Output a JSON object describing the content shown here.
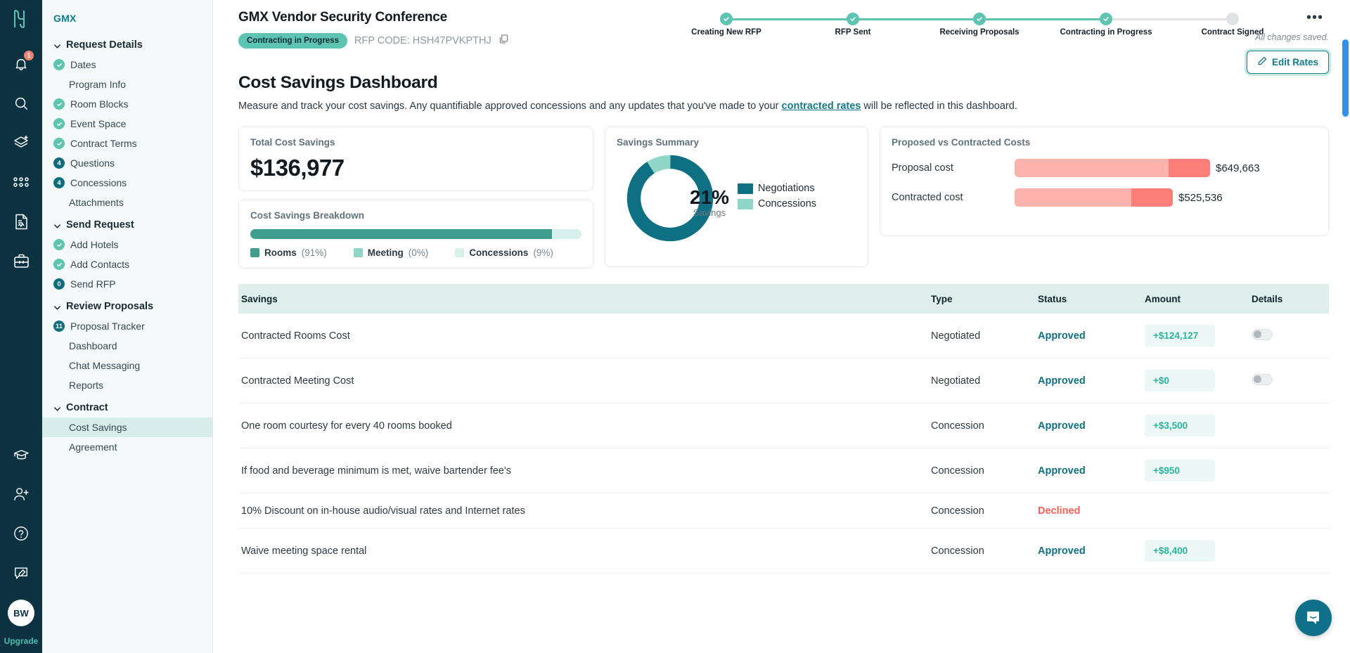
{
  "rail": {
    "logo_icon": "hopskip-logo-icon",
    "icons": [
      {
        "name": "notifications-bell-icon",
        "badge": "1"
      },
      {
        "name": "search-icon",
        "badge": ""
      },
      {
        "name": "add-layers-icon",
        "badge": ""
      },
      {
        "name": "grid-apps-icon",
        "badge": ""
      },
      {
        "name": "document-report-icon",
        "badge": ""
      },
      {
        "name": "briefcase-icon",
        "badge": ""
      }
    ],
    "bottom_icons": [
      {
        "name": "graduation-cap-icon"
      },
      {
        "name": "add-user-icon"
      },
      {
        "name": "help-circle-icon"
      },
      {
        "name": "feedback-pencil-icon"
      }
    ],
    "avatar_initials": "BW",
    "upgrade_label": "Upgrade"
  },
  "subnav": {
    "title": "GMX",
    "groups": [
      {
        "label": "Request Details",
        "items": [
          {
            "label": "Dates",
            "marker": "check",
            "marker_text": ""
          },
          {
            "label": "Program Info",
            "marker": "none",
            "marker_text": ""
          },
          {
            "label": "Room Blocks",
            "marker": "check",
            "marker_text": ""
          },
          {
            "label": "Event Space",
            "marker": "check",
            "marker_text": ""
          },
          {
            "label": "Contract Terms",
            "marker": "check",
            "marker_text": ""
          },
          {
            "label": "Questions",
            "marker": "count",
            "marker_text": "4"
          },
          {
            "label": "Concessions",
            "marker": "count",
            "marker_text": "4"
          },
          {
            "label": "Attachments",
            "marker": "none",
            "marker_text": ""
          }
        ]
      },
      {
        "label": "Send Request",
        "items": [
          {
            "label": "Add Hotels",
            "marker": "check",
            "marker_text": ""
          },
          {
            "label": "Add Contacts",
            "marker": "check",
            "marker_text": ""
          },
          {
            "label": "Send RFP",
            "marker": "count",
            "marker_text": "0"
          }
        ]
      },
      {
        "label": "Review Proposals",
        "items": [
          {
            "label": "Proposal Tracker",
            "marker": "count",
            "marker_text": "11"
          },
          {
            "label": "Dashboard",
            "marker": "none",
            "marker_text": ""
          },
          {
            "label": "Chat Messaging",
            "marker": "none",
            "marker_text": ""
          },
          {
            "label": "Reports",
            "marker": "none",
            "marker_text": ""
          }
        ]
      },
      {
        "label": "Contract",
        "items": [
          {
            "label": "Cost Savings",
            "marker": "none",
            "marker_text": "",
            "active": true
          },
          {
            "label": "Agreement",
            "marker": "none",
            "marker_text": ""
          }
        ]
      }
    ]
  },
  "header": {
    "title": "GMX Vendor Security Conference",
    "status_pill": "Contracting in Progress",
    "rfp_code": "RFP CODE: HSH47PVKPTHJ",
    "copy_icon": "copy-icon",
    "more_menu": "•••",
    "saved_text": "All changes saved.",
    "edit_rates_label": "Edit Rates",
    "edit_rates_icon": "pencil-icon"
  },
  "stepper": {
    "steps": [
      {
        "label": "Creating New RFP",
        "state": "complete"
      },
      {
        "label": "RFP Sent",
        "state": "complete"
      },
      {
        "label": "Receiving Proposals",
        "state": "complete"
      },
      {
        "label": "Contracting in Progress",
        "state": "complete"
      },
      {
        "label": "Contract Signed",
        "state": "pending"
      }
    ]
  },
  "page": {
    "title": "Cost Savings Dashboard",
    "desc_before": "Measure and track your cost savings. Any quantifiable approved concessions and any updates that you've made to your ",
    "desc_link": "contracted rates",
    "desc_after": " will be reflected in this dashboard."
  },
  "cards": {
    "total": {
      "title": "Total Cost Savings",
      "value": "$136,977"
    },
    "breakdown": {
      "title": "Cost Savings Breakdown"
    },
    "summary": {
      "title": "Savings Summary",
      "center_value": "21%",
      "center_label": "Savings"
    },
    "pvc": {
      "title": "Proposed vs Contracted Costs",
      "rows": [
        {
          "label": "Proposal cost",
          "value": "$649,663"
        },
        {
          "label": "Contracted cost",
          "value": "$525,536"
        }
      ]
    }
  },
  "chart_data": [
    {
      "type": "bar",
      "title": "Cost Savings Breakdown",
      "orientation": "horizontal-stacked",
      "categories": [
        "Rooms",
        "Meeting",
        "Concessions"
      ],
      "values": [
        91,
        0,
        9
      ],
      "value_labels": [
        "(91%)",
        "(0%)",
        "(9%)"
      ],
      "colors": [
        "#3f9e8e",
        "#8fd6c8",
        "#d6f0ec"
      ],
      "legend": [
        "Rooms (91%)",
        "Meeting (0%)",
        "Concessions (9%)"
      ],
      "legend_position": "bottom",
      "ylim": [
        0,
        100
      ],
      "xlabel": "",
      "ylabel": "",
      "grid": false
    },
    {
      "type": "pie",
      "subtype": "donut",
      "title": "Savings Summary",
      "labels": [
        "Negotiations",
        "Concessions"
      ],
      "values": [
        91,
        9
      ],
      "colors": [
        "#0f6f83",
        "#8fd6c8"
      ],
      "center_text": "21%",
      "center_subtext": "Savings",
      "legend": [
        "Negotiations",
        "Concessions"
      ],
      "legend_position": "right",
      "grid": false
    },
    {
      "type": "bar",
      "title": "Proposed vs Contracted Costs",
      "orientation": "horizontal",
      "categories": [
        "Proposal cost",
        "Contracted cost"
      ],
      "values": [
        649663,
        525536
      ],
      "value_labels": [
        "$649,663",
        "$525,536"
      ],
      "colors": [
        "#fcb3ad",
        "#fb7f78"
      ],
      "xlabel": "",
      "ylabel": "",
      "ylim": [
        0,
        649663
      ],
      "grid": false
    }
  ],
  "table": {
    "columns": [
      "Savings",
      "Type",
      "Status",
      "Amount",
      "Details"
    ],
    "rows": [
      {
        "savings": "Contracted Rooms Cost",
        "type": "Negotiated",
        "status": "Approved",
        "status_kind": "approved",
        "amount": "+$124,127",
        "details": "toggle"
      },
      {
        "savings": "Contracted Meeting Cost",
        "type": "Negotiated",
        "status": "Approved",
        "status_kind": "approved",
        "amount": "+$0",
        "details": "toggle"
      },
      {
        "savings": "One room courtesy for every 40 rooms booked",
        "type": "Concession",
        "status": "Approved",
        "status_kind": "approved",
        "amount": "+$3,500",
        "details": ""
      },
      {
        "savings": "If food and beverage minimum is met, waive bartender fee's",
        "type": "Concession",
        "status": "Approved",
        "status_kind": "approved",
        "amount": "+$950",
        "details": ""
      },
      {
        "savings": "10% Discount on in-house audio/visual rates and Internet rates",
        "type": "Concession",
        "status": "Declined",
        "status_kind": "declined",
        "amount": "",
        "details": ""
      },
      {
        "savings": "Waive meeting space rental",
        "type": "Concession",
        "status": "Approved",
        "status_kind": "approved",
        "amount": "+$8,400",
        "details": ""
      }
    ]
  },
  "chat": {
    "icon": "chat-bubble-icon"
  },
  "colors": {
    "rail_bg": "#0d3242",
    "brand_teal": "#127a87",
    "accent_mint": "#5ec4b2",
    "approved": "#13707e",
    "declined": "#f7635a",
    "amount_green": "#29b59c",
    "pink_light": "#fcb3ad",
    "pink_dark": "#fb7f78",
    "scrollbar": "#2f90ef"
  }
}
